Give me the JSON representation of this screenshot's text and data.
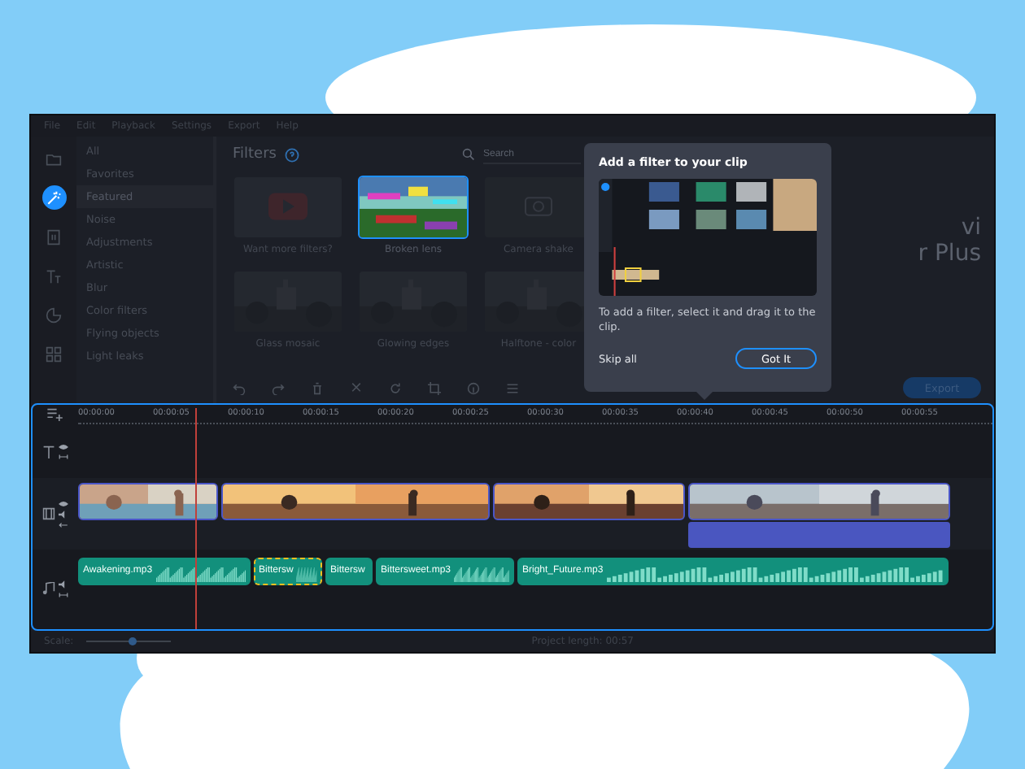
{
  "menu": [
    "File",
    "Edit",
    "Playback",
    "Settings",
    "Export",
    "Help"
  ],
  "sidebar": [
    {
      "kind": "import",
      "selected": false
    },
    {
      "kind": "filters",
      "selected": true
    },
    {
      "kind": "transitions",
      "selected": false
    },
    {
      "kind": "titles",
      "selected": false
    },
    {
      "kind": "stickers",
      "selected": false
    },
    {
      "kind": "more",
      "selected": false
    }
  ],
  "categories": [
    {
      "label": "All",
      "selected": false
    },
    {
      "label": "Favorites",
      "selected": false
    },
    {
      "label": "Featured",
      "selected": true
    },
    {
      "label": "Noise",
      "selected": false
    },
    {
      "label": "Adjustments",
      "selected": false
    },
    {
      "label": "Artistic",
      "selected": false
    },
    {
      "label": "Blur",
      "selected": false
    },
    {
      "label": "Color filters",
      "selected": false
    },
    {
      "label": "Flying objects",
      "selected": false
    },
    {
      "label": "Light leaks",
      "selected": false
    }
  ],
  "filters": {
    "title": "Filters",
    "search": {
      "placeholder": "Search"
    },
    "items": [
      {
        "label": "Want more filters?",
        "kind": "promo",
        "selected": false
      },
      {
        "label": "Broken lens",
        "kind": "glitch",
        "selected": true
      },
      {
        "label": "Camera shake",
        "kind": "shake",
        "selected": false
      },
      {
        "label": "Glass mosaic",
        "kind": "castle",
        "selected": false
      },
      {
        "label": "Glowing edges",
        "kind": "castle",
        "selected": false
      },
      {
        "label": "Halftone - color",
        "kind": "castle",
        "selected": false
      }
    ]
  },
  "preview": {
    "lines": [
      "vi",
      "r Plus"
    ]
  },
  "export_button": "Export",
  "popup": {
    "title": "Add a filter to your clip",
    "text": "To add a filter, select it and drag it to the clip.",
    "skip": "Skip all",
    "confirm": "Got It"
  },
  "timeline": {
    "ruler": [
      "00:00:00",
      "00:00:05",
      "00:00:10",
      "00:00:15",
      "00:00:20",
      "00:00:25",
      "00:00:30",
      "00:00:35",
      "00:00:40",
      "00:00:45",
      "00:00:50",
      "00:00:55"
    ],
    "playhead": {
      "level": 0.13
    },
    "video_clips": [
      {
        "kind": "beach"
      },
      {
        "kind": "party"
      },
      {
        "kind": "sunset"
      },
      {
        "kind": "woman",
        "effect": true
      }
    ],
    "audio_clips": [
      {
        "label": "Awakening.mp3",
        "selected": false
      },
      {
        "label": "Bittersw",
        "selected": true
      },
      {
        "label": "Bittersw",
        "selected": false
      },
      {
        "label": "Bittersweet.mp3",
        "selected": false
      },
      {
        "label": "Bright_Future.mp3",
        "selected": false
      }
    ]
  },
  "status": {
    "scale_label": "Scale:",
    "scale": {
      "level": 0.55
    },
    "project_length": "Project length: 00:57"
  }
}
